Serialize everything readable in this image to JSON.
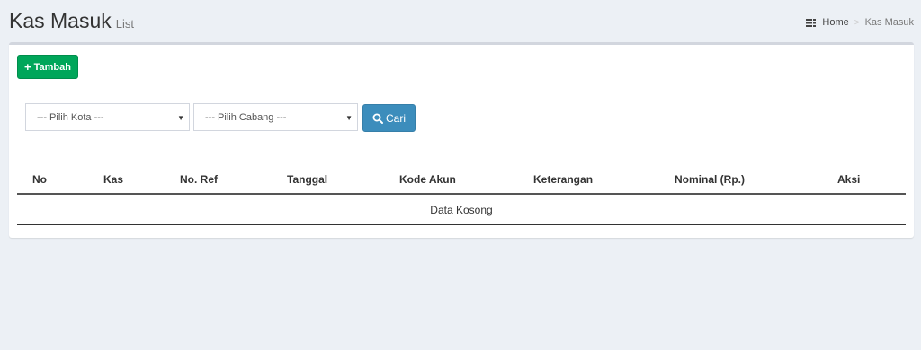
{
  "header": {
    "title": "Kas Masuk",
    "subtitle": "List"
  },
  "breadcrumb": {
    "icon": "dashboard-grid-icon",
    "home": "Home",
    "separator": ">",
    "current": "Kas Masuk"
  },
  "toolbar": {
    "add_label": "Tambah",
    "add_icon": "plus-icon"
  },
  "filters": {
    "kota": {
      "selected": "--- Pilih Kota ---"
    },
    "cabang": {
      "selected": "--- Pilih Cabang ---"
    },
    "search_label": "Cari",
    "search_icon": "search-icon"
  },
  "table": {
    "columns": [
      "No",
      "Kas",
      "No. Ref",
      "Tanggal",
      "Kode Akun",
      "Keterangan",
      "Nominal (Rp.)",
      "Aksi"
    ],
    "empty_text": "Data Kosong"
  },
  "colors": {
    "add_button": "#00a65a",
    "search_button": "#3c8dbc",
    "background": "#ecf0f5"
  }
}
